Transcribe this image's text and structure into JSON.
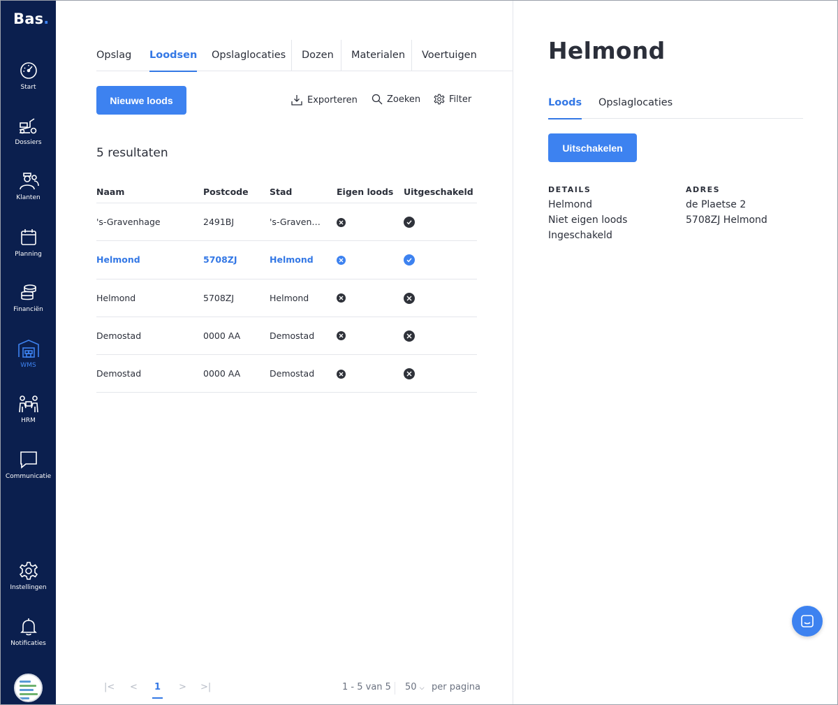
{
  "app": {
    "logo_text": "Bas",
    "logo_dot": "."
  },
  "sidebar": {
    "items": [
      {
        "label": "Start",
        "icon": "dashboard-icon"
      },
      {
        "label": "Dossiers",
        "icon": "dossiers-icon"
      },
      {
        "label": "Klanten",
        "icon": "customers-icon"
      },
      {
        "label": "Planning",
        "icon": "calendar-icon"
      },
      {
        "label": "Financiën",
        "icon": "coins-icon"
      },
      {
        "label": "WMS",
        "icon": "warehouse-icon",
        "active": true
      },
      {
        "label": "HRM",
        "icon": "people-icon"
      },
      {
        "label": "Communicatie",
        "icon": "chat-icon"
      },
      {
        "label": "Instellingen",
        "icon": "gear-icon"
      },
      {
        "label": "Notificaties",
        "icon": "bell-icon"
      }
    ]
  },
  "main": {
    "tabs": [
      {
        "label": "Opslag"
      },
      {
        "label": "Loodsen",
        "active": true
      },
      {
        "label": "Opslaglocaties"
      },
      {
        "label": "Dozen"
      },
      {
        "label": "Materialen"
      },
      {
        "label": "Voertuigen"
      }
    ],
    "new_button": "Nieuwe loods",
    "toolbar": {
      "export": "Exporteren",
      "search": "Zoeken",
      "filter": "Filter"
    },
    "results_text": "5 resultaten",
    "table": {
      "columns": [
        "Naam",
        "Postcode",
        "Stad",
        "Eigen loods",
        "Uitgeschakeld"
      ],
      "rows": [
        {
          "naam": "'s-Gravenhage",
          "postcode": "2491BJ",
          "stad": "'s-Gravenh...",
          "eigen_loods": false,
          "uitgeschakeld": true,
          "selected": false
        },
        {
          "naam": "Helmond",
          "postcode": "5708ZJ",
          "stad": "Helmond",
          "eigen_loods": false,
          "uitgeschakeld": true,
          "selected": true
        },
        {
          "naam": "Helmond",
          "postcode": "5708ZJ",
          "stad": "Helmond",
          "eigen_loods": false,
          "uitgeschakeld": false,
          "selected": false
        },
        {
          "naam": "Demostad",
          "postcode": "0000 AA",
          "stad": "Demostad",
          "eigen_loods": false,
          "uitgeschakeld": false,
          "selected": false
        },
        {
          "naam": "Demostad",
          "postcode": "0000 AA",
          "stad": "Demostad",
          "eigen_loods": false,
          "uitgeschakeld": false,
          "selected": false
        }
      ]
    },
    "pagination": {
      "current_page": "1",
      "range_text": "1 - 5 van 5",
      "per_page_value": "50",
      "per_page_label": "per pagina"
    }
  },
  "detail": {
    "title": "Helmond",
    "tabs": [
      {
        "label": "Loods",
        "active": true
      },
      {
        "label": "Opslaglocaties"
      }
    ],
    "action_button": "Uitschakelen",
    "details": {
      "heading": "DETAILS",
      "lines": [
        "Helmond",
        "Niet eigen loods",
        "Ingeschakeld"
      ]
    },
    "address": {
      "heading": "ADRES",
      "lines": [
        "de Plaetse 2",
        "5708ZJ Helmond"
      ]
    }
  },
  "colors": {
    "sidebar_bg": "#0b1f4e",
    "accent": "#3d82f0",
    "text": "#2b2f3a"
  }
}
